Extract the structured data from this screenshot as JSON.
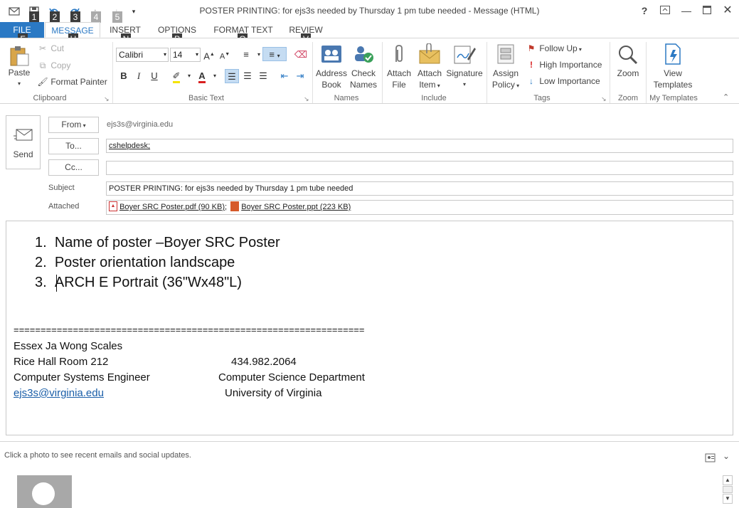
{
  "window": {
    "title": "POSTER PRINTING: for ejs3s needed by Thursday 1 pm tube needed - Message (HTML)",
    "help_symbol": "?",
    "keytips_qat": [
      "1",
      "2",
      "3",
      "4",
      "5"
    ]
  },
  "tabs": [
    {
      "label": "FILE",
      "keytip": "F"
    },
    {
      "label": "MESSAGE",
      "keytip": "H"
    },
    {
      "label": "INSERT",
      "keytip": "N"
    },
    {
      "label": "OPTIONS",
      "keytip": "P"
    },
    {
      "label": "FORMAT TEXT",
      "keytip": "O"
    },
    {
      "label": "REVIEW",
      "keytip": "V"
    }
  ],
  "ribbon": {
    "clipboard": {
      "paste": "Paste",
      "cut": "Cut",
      "copy": "Copy",
      "format_painter": "Format Painter",
      "group": "Clipboard"
    },
    "basic_text": {
      "font": "Calibri",
      "size": "14",
      "group": "Basic Text",
      "bold": "B",
      "italic": "I",
      "underline": "U"
    },
    "names": {
      "address_book_1": "Address",
      "address_book_2": "Book",
      "check_names_1": "Check",
      "check_names_2": "Names",
      "group": "Names"
    },
    "include": {
      "attach_file_1": "Attach",
      "attach_file_2": "File",
      "attach_item_1": "Attach",
      "attach_item_2": "Item",
      "signature": "Signature",
      "group": "Include"
    },
    "tags": {
      "assign_policy_1": "Assign",
      "assign_policy_2": "Policy",
      "follow_up": "Follow Up",
      "high_importance": "High Importance",
      "low_importance": "Low Importance",
      "group": "Tags"
    },
    "zoom": {
      "zoom": "Zoom",
      "group": "Zoom"
    },
    "templates": {
      "view_1": "View",
      "view_2": "Templates",
      "group": "My Templates"
    }
  },
  "header": {
    "send": "Send",
    "from_label": "From",
    "from_value": "ejs3s@virginia.edu",
    "to_label": "To...",
    "to_value": "cshelpdesk;",
    "cc_label": "Cc...",
    "cc_value": "",
    "subject_label": "Subject",
    "subject_value": "POSTER PRINTING: for ejs3s needed by Thursday 1 pm tube needed",
    "attached_label": "Attached",
    "attachments": [
      {
        "name": "Boyer SRC Poster.pdf (90 KB)",
        "sep": ";"
      },
      {
        "name": "Boyer SRC Poster.ppt (223 KB)",
        "sep": ""
      }
    ]
  },
  "body": {
    "list": [
      {
        "num": "1.",
        "text": "Name of poster –Boyer SRC Poster"
      },
      {
        "num": "2.",
        "text": "Poster orientation landscape"
      },
      {
        "num": "3.",
        "text": "ARCH E Portrait (36\"Wx48\"L)"
      }
    ],
    "separator": "=================================================================",
    "signature": {
      "name": "Essex Ja Wong Scales",
      "room": "Rice Hall Room 212",
      "phone": "434.982.2064",
      "title": "Computer Systems Engineer",
      "dept": "Computer Science Department",
      "email": "ejs3s@virginia.edu",
      "university": "University of Virginia"
    }
  },
  "people_pane": {
    "hint": "Click a photo to see recent emails and social updates."
  },
  "colors": {
    "accent": "#2b79c4",
    "keytip_bg": "#3c3c3c",
    "link": "#1a5ea8"
  }
}
